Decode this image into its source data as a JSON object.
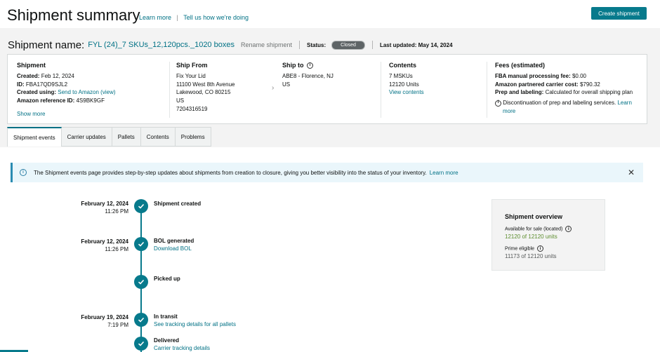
{
  "header": {
    "title": "Shipment summary",
    "learn_more": "Learn more",
    "separator": "|",
    "feedback": "Tell us how we're doing",
    "create_button": "Create shipment",
    "accent_color": "#077a8c"
  },
  "shipment_bar": {
    "name_label": "Shipment name:",
    "name_value": "FYL (24)_7 SKUs_12,120pcs._1020 boxes",
    "rename": "Rename shipment",
    "status_label": "Status:",
    "status_value": "Closed",
    "last_updated": "Last updated: May 14, 2024"
  },
  "summary": {
    "shipment": {
      "title": "Shipment",
      "created_label": "Created:",
      "created_value": "Feb 12, 2024",
      "id_label": "ID:",
      "id_value": "FBA17QD9SJL2",
      "created_using_label": "Created using:",
      "created_using_value": "Send to Amazon (view)",
      "ref_label": "Amazon reference ID:",
      "ref_value": "4S9BK9GF",
      "show_more": "Show more"
    },
    "ship_from": {
      "title": "Ship From",
      "lines": [
        "Fix Your Lid",
        "11100 West 8th Avenue",
        "Lakewood, CO 80215",
        "US",
        "7204316519"
      ]
    },
    "ship_to": {
      "title": "Ship to",
      "lines": [
        "ABE8 - Florence, NJ",
        "US"
      ]
    },
    "contents": {
      "title": "Contents",
      "mskus": "7 MSKUs",
      "units": "12120 Units",
      "view": "View contents"
    },
    "fees": {
      "title": "Fees (estimated)",
      "fba_label": "FBA manual processing fee:",
      "fba_value": "$0.00",
      "carrier_label": "Amazon partnered carrier cost:",
      "carrier_value": "$790.32",
      "prep_label": "Prep and labeling:",
      "prep_value": "Calculated for overall shipping plan",
      "notice": "Discontinuation of prep and labeling services.",
      "learn": "Learn",
      "more": "more"
    }
  },
  "tabs": [
    "Shipment events",
    "Carrier updates",
    "Pallets",
    "Contents",
    "Problems"
  ],
  "banner": {
    "text": "The Shipment events page provides step-by-step updates about shipments from creation to closure, giving you better visibility into the status of your inventory.",
    "link": "Learn more"
  },
  "events": [
    {
      "date": "February 12, 2024",
      "time": "11:26 PM",
      "title": "Shipment created",
      "link": ""
    },
    {
      "date": "February 12, 2024",
      "time": "11:26 PM",
      "title": "BOL generated",
      "link": "Download BOL"
    },
    {
      "date": "",
      "time": "",
      "title": "Picked up",
      "link": ""
    },
    {
      "date": "February 19, 2024",
      "time": "7:19 PM",
      "title": "In transit",
      "link": "See tracking details for all pallets"
    },
    {
      "date": "",
      "time": "",
      "title": "Delivered",
      "link": "Carrier tracking details"
    }
  ],
  "overview": {
    "title": "Shipment overview",
    "available_label": "Available for sale (located)",
    "available_value": "12120 of 12120 units",
    "prime_label": "Prime eligible",
    "prime_value": "11173 of 12120 units"
  }
}
